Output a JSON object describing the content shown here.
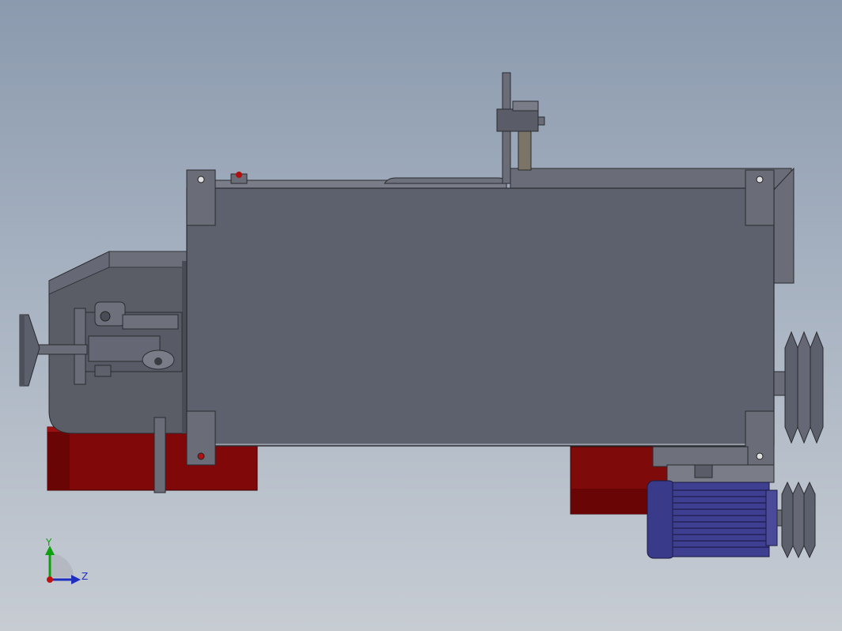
{
  "viewport": {
    "background_top": "#8b9aae",
    "background_bottom": "#c7ccd3"
  },
  "model": {
    "parts": [
      {
        "name": "main-housing",
        "color": "#5d606d"
      },
      {
        "name": "left-gear-cover",
        "color": "#5a5c66"
      },
      {
        "name": "base-block-left",
        "color": "#800808"
      },
      {
        "name": "base-block-right",
        "color": "#7e0a0a"
      },
      {
        "name": "electric-motor",
        "color": "#3a3a8a"
      },
      {
        "name": "v-belt-pulleys",
        "color": "#5c5f6c"
      },
      {
        "name": "handwheel",
        "color": "#5c5f6c"
      },
      {
        "name": "top-lever",
        "color": "#6a6d78"
      },
      {
        "name": "red-knob",
        "color": "#b01010"
      }
    ]
  },
  "triad": {
    "y_label": "Y",
    "z_label": "Z",
    "y_color": "#0fa00f",
    "z_color": "#1e2fc0",
    "x_color": "#c01010"
  }
}
